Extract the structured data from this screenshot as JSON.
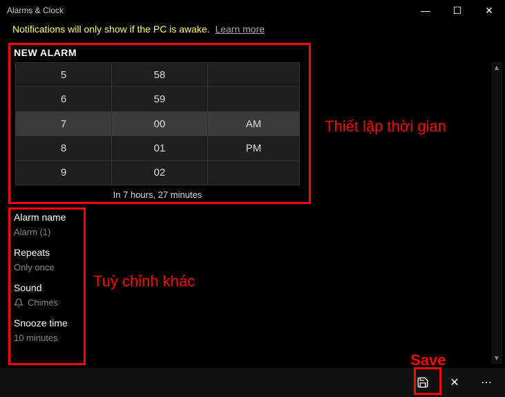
{
  "title": "Alarms & Clock",
  "notification": {
    "text": "Notifications will only show if the PC is awake.",
    "learn_more": "Learn more"
  },
  "new_alarm_label": "NEW ALARM",
  "time_picker": {
    "hours": [
      "5",
      "6",
      "7",
      "8",
      "9"
    ],
    "minutes": [
      "58",
      "59",
      "00",
      "01",
      "02"
    ],
    "ampm": [
      "",
      "",
      "AM",
      "PM",
      ""
    ],
    "selected_index": 2,
    "remaining": "In 7 hours, 27 minutes"
  },
  "options": {
    "name_label": "Alarm name",
    "name_value": "Alarm (1)",
    "repeats_label": "Repeats",
    "repeats_value": "Only once",
    "sound_label": "Sound",
    "sound_value": "Chimes",
    "snooze_label": "Snooze time",
    "snooze_value": "10 minutes"
  },
  "annotations": {
    "time": "Thiết lập thời gian",
    "other": "Tuỳ chỉnh khác",
    "save": "Save"
  },
  "win": {
    "min": "—",
    "max": "☐",
    "close": "✕"
  },
  "cmd": {
    "save": "💾",
    "cancel": "✕",
    "more": "⋯"
  },
  "scroll": {
    "up": "▲",
    "down": "▼"
  }
}
